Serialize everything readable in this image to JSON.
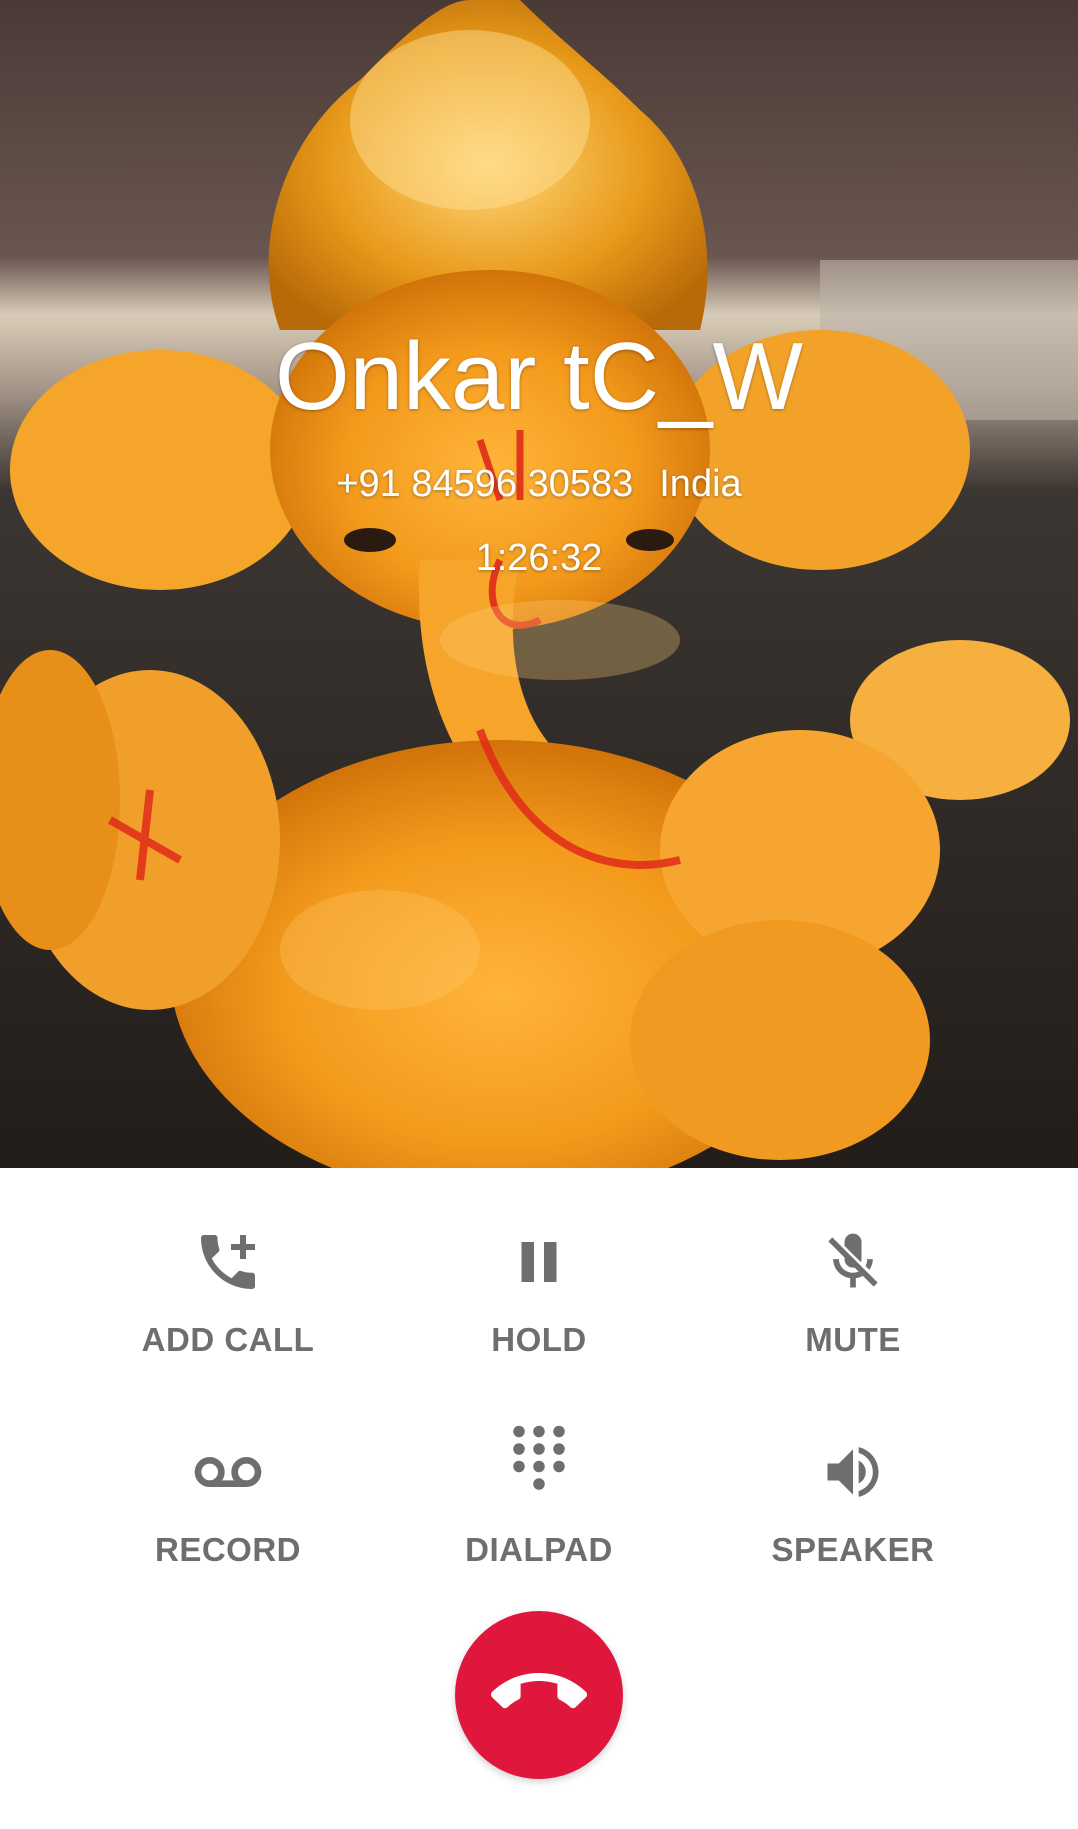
{
  "caller": {
    "name": "Onkar tC_W",
    "number": "+91 84596 30583",
    "location": "India",
    "timer": "1:26:32"
  },
  "controls": {
    "row1": [
      {
        "label": "ADD CALL",
        "icon": "add-call-icon"
      },
      {
        "label": "HOLD",
        "icon": "pause-icon"
      },
      {
        "label": "MUTE",
        "icon": "mic-off-icon"
      }
    ],
    "row2": [
      {
        "label": "RECORD",
        "icon": "voicemail-icon"
      },
      {
        "label": "DIALPAD",
        "icon": "dialpad-icon"
      },
      {
        "label": "SPEAKER",
        "icon": "speaker-icon"
      }
    ]
  },
  "end_call": {
    "icon": "end-call-icon"
  },
  "colors": {
    "accent_end_call": "#e0173d",
    "control_gray": "#6e6e6e",
    "text_on_photo": "#ffffff"
  }
}
